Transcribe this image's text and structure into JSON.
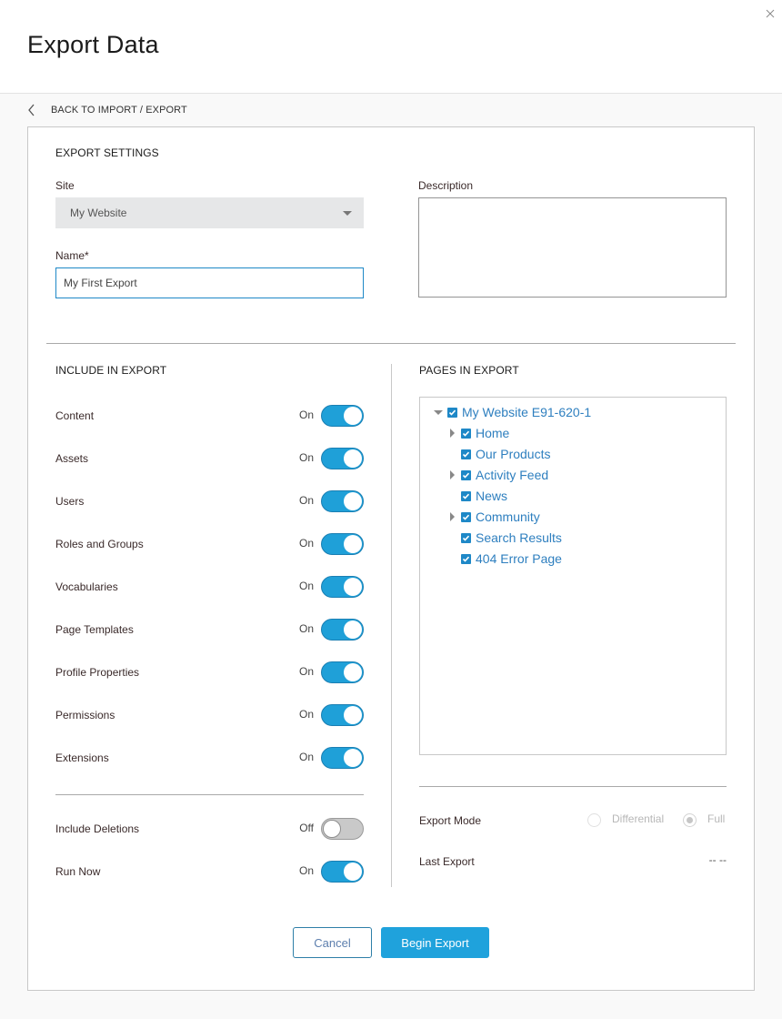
{
  "header": {
    "title": "Export Data",
    "close_icon": "close-icon"
  },
  "back_link": {
    "label": "BACK TO IMPORT / EXPORT",
    "icon": "chevron-left-icon"
  },
  "export_settings": {
    "heading": "EXPORT SETTINGS",
    "site": {
      "label": "Site",
      "value": "My Website"
    },
    "name": {
      "label": "Name*",
      "value": "My First Export"
    },
    "description": {
      "label": "Description",
      "value": ""
    }
  },
  "include_in_export": {
    "heading": "INCLUDE IN EXPORT",
    "items": [
      {
        "label": "Content",
        "state": "On",
        "on": true
      },
      {
        "label": "Assets",
        "state": "On",
        "on": true
      },
      {
        "label": "Users",
        "state": "On",
        "on": true
      },
      {
        "label": "Roles and Groups",
        "state": "On",
        "on": true
      },
      {
        "label": "Vocabularies",
        "state": "On",
        "on": true
      },
      {
        "label": "Page Templates",
        "state": "On",
        "on": true
      },
      {
        "label": "Profile Properties",
        "state": "On",
        "on": true
      },
      {
        "label": "Permissions",
        "state": "On",
        "on": true
      },
      {
        "label": "Extensions",
        "state": "On",
        "on": true
      }
    ],
    "extra": [
      {
        "label": "Include Deletions",
        "state": "Off",
        "on": false
      },
      {
        "label": "Run Now",
        "state": "On",
        "on": true
      }
    ]
  },
  "pages_in_export": {
    "heading": "PAGES IN EXPORT",
    "root": {
      "label": "My Website E91-620-1",
      "checked": true,
      "expanded": true
    },
    "children": [
      {
        "label": "Home",
        "checked": true,
        "has_children": true
      },
      {
        "label": "Our Products",
        "checked": true,
        "has_children": false
      },
      {
        "label": "Activity Feed",
        "checked": true,
        "has_children": true
      },
      {
        "label": "News",
        "checked": true,
        "has_children": false
      },
      {
        "label": "Community",
        "checked": true,
        "has_children": true
      },
      {
        "label": "Search Results",
        "checked": true,
        "has_children": false
      },
      {
        "label": "404 Error Page",
        "checked": true,
        "has_children": false
      }
    ]
  },
  "export_mode": {
    "label": "Export Mode",
    "options": [
      {
        "label": "Differential",
        "selected": false
      },
      {
        "label": "Full",
        "selected": true
      }
    ]
  },
  "last_export": {
    "label": "Last Export",
    "value": "-- --"
  },
  "buttons": {
    "cancel": "Cancel",
    "begin": "Begin Export"
  },
  "colors": {
    "accent": "#1fa0d8",
    "link": "#2e7fbf",
    "toggle_off": "#c9c9c9"
  }
}
